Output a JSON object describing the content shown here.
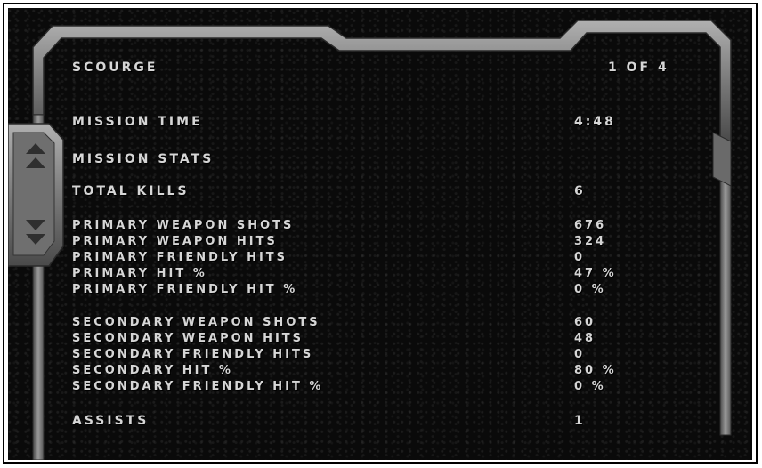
{
  "header": {
    "title": "Scourge",
    "page_indicator": "1 of 4"
  },
  "mission": {
    "time_label": "Mission Time",
    "time_value": "4:48",
    "stats_label": "Mission Stats"
  },
  "stats": {
    "total_kills": {
      "label": "Total kills",
      "value": "6"
    },
    "primary": [
      {
        "label": "Primary weapon shots",
        "value": "676"
      },
      {
        "label": "Primary weapon hits",
        "value": "324"
      },
      {
        "label": "Primary friendly hits",
        "value": "0"
      },
      {
        "label": "Primary hit %",
        "value": "47 %"
      },
      {
        "label": "Primary friendly hit %",
        "value": "0 %"
      }
    ],
    "secondary": [
      {
        "label": "Secondary weapon shots",
        "value": "60"
      },
      {
        "label": "Secondary weapon hits",
        "value": "48"
      },
      {
        "label": "Secondary friendly hits",
        "value": "0"
      },
      {
        "label": "Secondary hit %",
        "value": "80 %"
      },
      {
        "label": "Secondary friendly hit %",
        "value": "0 %"
      }
    ],
    "assists": {
      "label": "Assists",
      "value": "1"
    }
  },
  "icons": {
    "scroll_up": "double-up-arrow-icon",
    "scroll_down": "double-down-arrow-icon"
  },
  "colors": {
    "text": "#d6d6d6",
    "panel_background": "#0a0a0a",
    "bezel_metal": "#8a8a8a"
  }
}
